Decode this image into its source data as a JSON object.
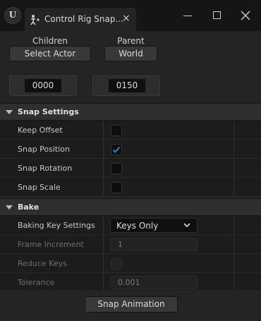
{
  "window": {
    "tab_title": "Control Rig Snap...",
    "tab_close_glyph": "×",
    "logo_icon": "unreal-engine-logo-icon",
    "tab_icon": "control-rig-icon"
  },
  "top": {
    "children_label": "Children",
    "children_button": "Select Actor",
    "parent_label": "Parent",
    "parent_button": "World",
    "start_frame": "0000",
    "end_frame": "0150"
  },
  "snap_settings": {
    "title": "Snap Settings",
    "rows": [
      {
        "label": "Keep Offset",
        "checked": false
      },
      {
        "label": "Snap Position",
        "checked": true
      },
      {
        "label": "Snap Rotation",
        "checked": false
      },
      {
        "label": "Snap Scale",
        "checked": false
      }
    ]
  },
  "bake": {
    "title": "Bake",
    "baking_key_settings_label": "Baking Key Settings",
    "baking_key_settings_value": "Keys Only",
    "frame_increment_label": "Frame Increment",
    "frame_increment_value": "1",
    "reduce_keys_label": "Reduce Keys",
    "reduce_keys_checked": false,
    "tolerance_label": "Tolerance",
    "tolerance_value": "0.001"
  },
  "footer": {
    "snap_button": "Snap Animation"
  },
  "colors": {
    "accent_check": "#2f7fe0",
    "background": "#242424"
  }
}
